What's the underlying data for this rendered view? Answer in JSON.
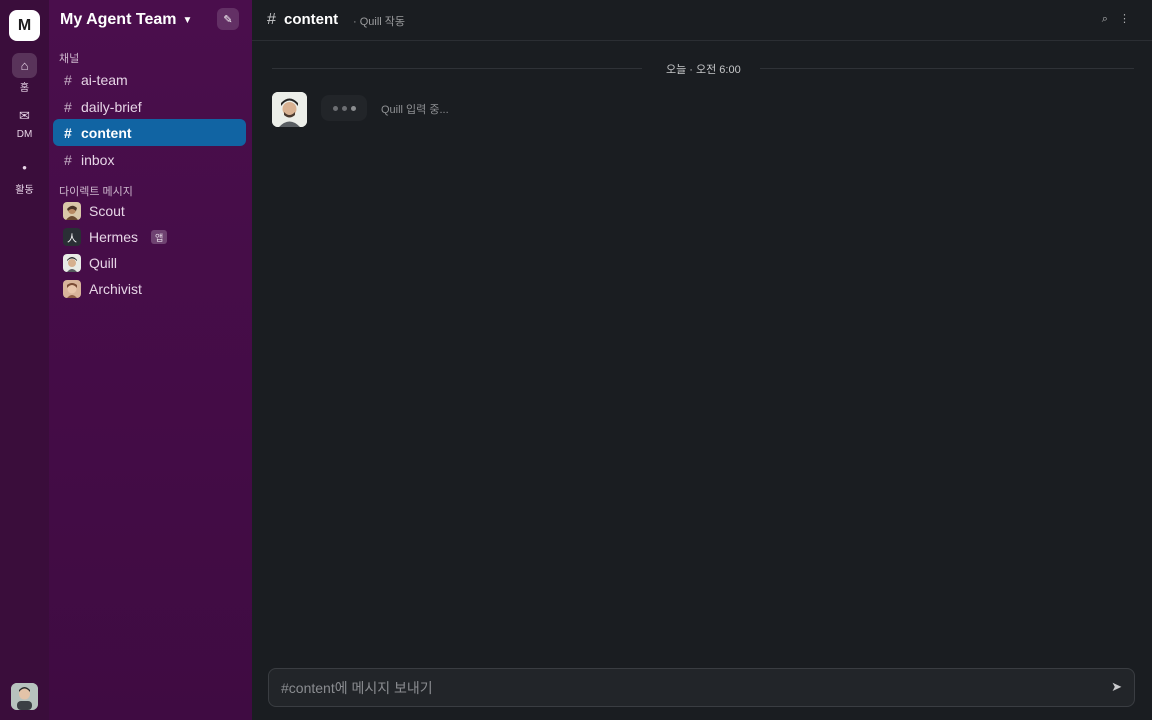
{
  "workspace": {
    "initial": "M",
    "name": "My Agent Team"
  },
  "rail": [
    {
      "icon": "⌂",
      "label": "홈",
      "active": true
    },
    {
      "icon": "✉",
      "label": "DM"
    },
    {
      "icon": "•",
      "label": "활동"
    }
  ],
  "sidebar": {
    "channels_label": "채널",
    "channels": [
      {
        "name": "ai-team"
      },
      {
        "name": "daily-brief"
      },
      {
        "name": "content",
        "active": true
      },
      {
        "name": "inbox"
      }
    ],
    "dms_label": "다이렉트 메시지",
    "dms": [
      {
        "name": "Scout"
      },
      {
        "name": "Hermes",
        "avatar_text": "人",
        "badge": "앱"
      },
      {
        "name": "Quill"
      },
      {
        "name": "Archivist"
      }
    ]
  },
  "channel": {
    "hash": "#",
    "name": "content",
    "subtitle": "· Quill 작동",
    "icons": "⌕ ⋮"
  },
  "messages": {
    "date_divider": "오늘 · 오전 6:00",
    "typing_text": "Quill 입력 중..."
  },
  "composer": {
    "placeholder": "#content에 메시지 보내기",
    "send_icon": "➤"
  },
  "colors": {
    "sidebar_bg": "#4a0e4c",
    "rail_bg": "#3a0d3b",
    "active_channel": "#1164a3",
    "main_bg": "#1a1d21"
  }
}
